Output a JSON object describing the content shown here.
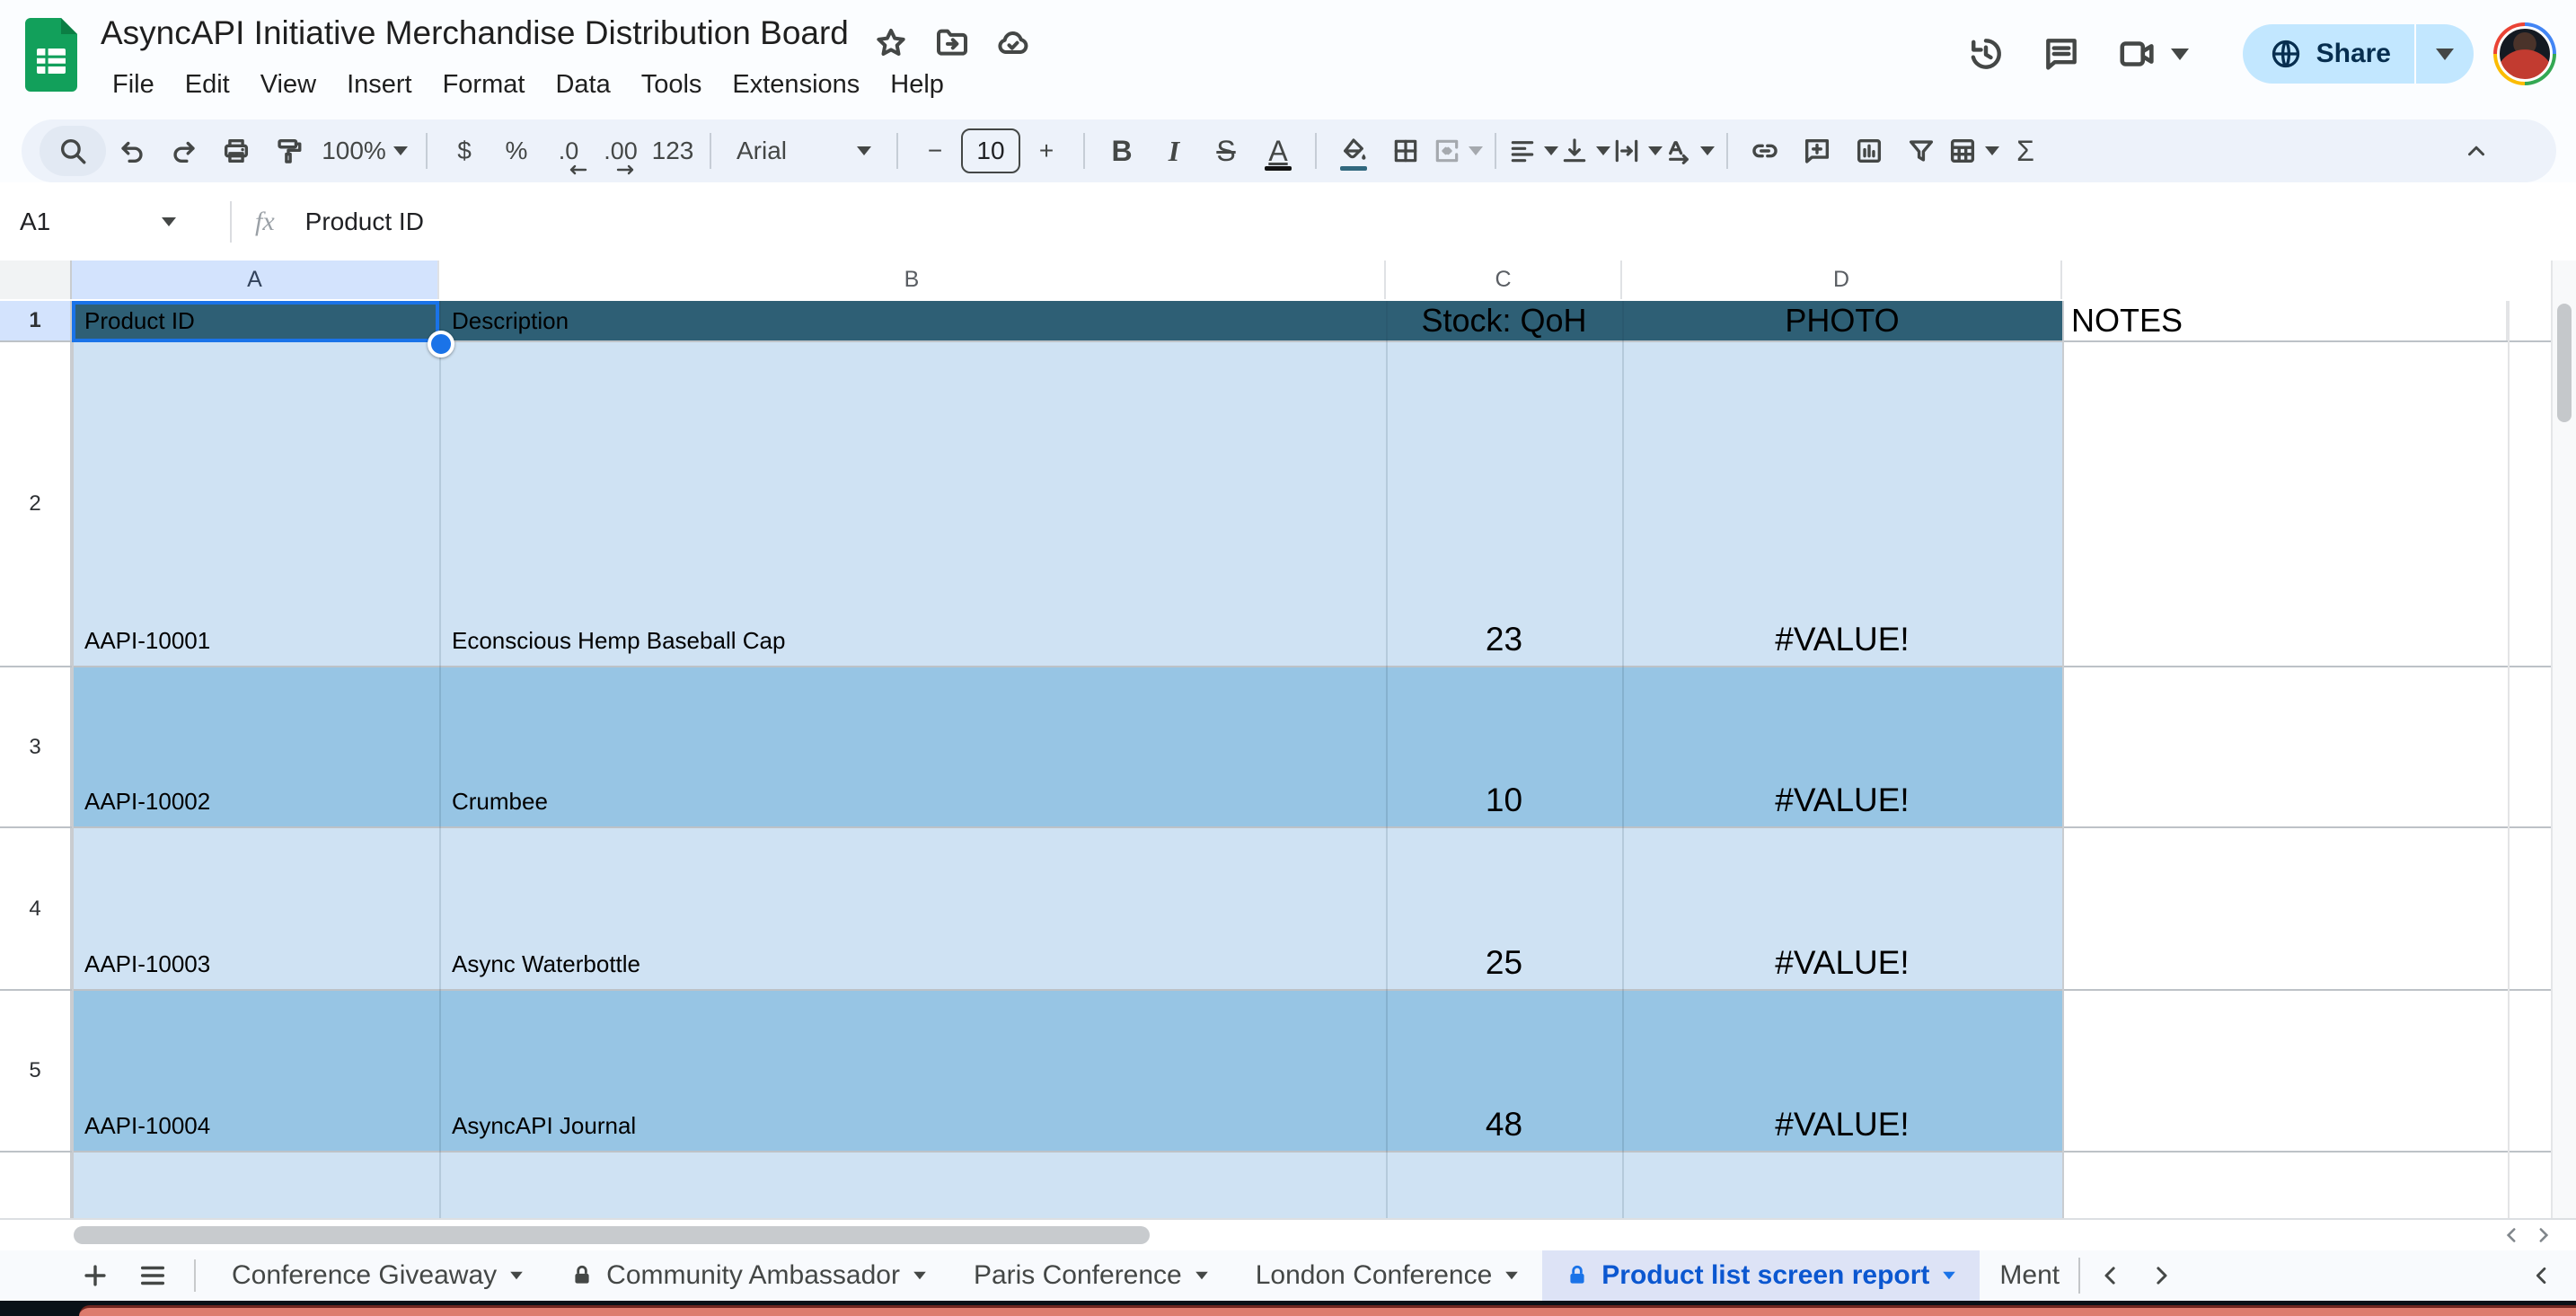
{
  "header": {
    "title": "AsyncAPI Initiative Merchandise Distribution Board",
    "menu": [
      "File",
      "Edit",
      "View",
      "Insert",
      "Format",
      "Data",
      "Tools",
      "Extensions",
      "Help"
    ],
    "share_label": "Share"
  },
  "toolbar": {
    "zoom": "100%",
    "currency": "$",
    "percent": "%",
    "decimal_decrease": ".0",
    "decimal_increase": ".00",
    "number_format": "123",
    "font_name": "Arial",
    "font_size": "10",
    "bold": "B",
    "italic": "I",
    "strikethrough": "S",
    "text_color": "A",
    "minus": "−",
    "plus": "+",
    "functions": "Σ"
  },
  "formula_bar": {
    "cell_ref": "A1",
    "fx": "fx",
    "value": "Product ID"
  },
  "grid": {
    "column_letters": [
      "A",
      "B",
      "C",
      "D"
    ],
    "header_row": {
      "row_number": "1",
      "product_id": "Product ID",
      "description": "Description",
      "stock": "Stock: QoH",
      "photo": "PHOTO",
      "notes": "NOTES"
    },
    "rows": [
      {
        "n": "2",
        "id": "AAPI-10001",
        "desc": "Econscious Hemp Baseball Cap",
        "stock": "23",
        "photo": "#VALUE!"
      },
      {
        "n": "3",
        "id": "AAPI-10002",
        "desc": "Crumbee",
        "stock": "10",
        "photo": "#VALUE!"
      },
      {
        "n": "4",
        "id": "AAPI-10003",
        "desc": "Async Waterbottle",
        "stock": "25",
        "photo": "#VALUE!"
      },
      {
        "n": "5",
        "id": "AAPI-10004",
        "desc": "AsyncAPI Journal",
        "stock": "48",
        "photo": "#VALUE!"
      }
    ]
  },
  "sheet_tabs": {
    "items": [
      {
        "label": "Conference Giveaway",
        "locked": false,
        "active": false
      },
      {
        "label": "Community Ambassador",
        "locked": true,
        "active": false
      },
      {
        "label": "Paris Conference",
        "locked": false,
        "active": false
      },
      {
        "label": "London Conference",
        "locked": false,
        "active": false
      },
      {
        "label": "Product list screen report",
        "locked": true,
        "active": true
      },
      {
        "label": "Ment",
        "locked": false,
        "active": false
      }
    ]
  },
  "colors": {
    "header_row_fill": "#2e5f75",
    "row_light": "#cfe2f3",
    "row_dark": "#97c5e4",
    "selection_blue": "#1a73e8",
    "selected_header_fill": "#d3e3fd",
    "active_tab_bg": "#dde3f6",
    "active_tab_text": "#0b57d0",
    "share_button_bg": "#c2e7ff",
    "logo_green": "#12a05b"
  }
}
